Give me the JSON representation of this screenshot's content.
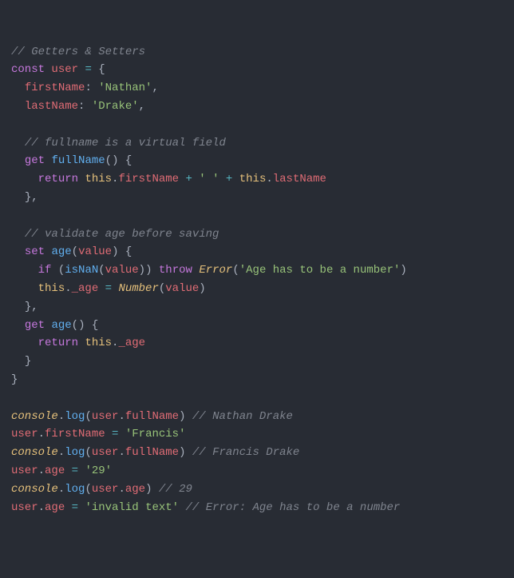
{
  "c1": "// Getters & Setters",
  "k_const": "const",
  "id_user": "user",
  "op_eq": "=",
  "br_open": "{",
  "prop_firstName": "firstName",
  "colon": ":",
  "str_nathan": "'Nathan'",
  "comma": ",",
  "prop_lastName": "lastName",
  "str_drake": "'Drake'",
  "c2": "// fullname is a virtual field",
  "k_get": "get",
  "fn_fullName": "fullName",
  "paren_o": "(",
  "paren_c": ")",
  "k_return": "return",
  "k_this": "this",
  "dot": ".",
  "op_plus": "+",
  "str_space": "' '",
  "br_close": "}",
  "c3": "// validate age before saving",
  "k_set": "set",
  "fn_age": "age",
  "id_value": "value",
  "k_if": "if",
  "fn_isNaN": "isNaN",
  "k_throw": "throw",
  "fn_Error": "Error",
  "str_ageerr": "'Age has to be a number'",
  "prop_uage": "_age",
  "fn_Number": "Number",
  "obj_console": "console",
  "fn_log": "log",
  "c4": "// Nathan Drake",
  "str_francis": "'Francis'",
  "c5": "// Francis Drake",
  "prop_age": "age",
  "str_29": "'29'",
  "c6": "// 29",
  "str_invalid": "'invalid text'",
  "c7": "// Error: Age has to be a number"
}
